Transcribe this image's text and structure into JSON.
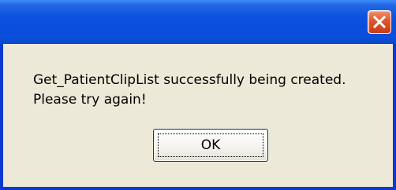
{
  "dialog": {
    "title": "",
    "message_lines": [
      "Get_PatientClipList successfully being created.",
      "Please try again!"
    ],
    "ok_label": "OK",
    "close_icon": "close-icon"
  },
  "colors": {
    "titlebar_blue": "#0a4ddb",
    "frame_blue": "#0a3ad0",
    "dialog_background": "#ece9d8",
    "close_red": "#e0552c"
  }
}
